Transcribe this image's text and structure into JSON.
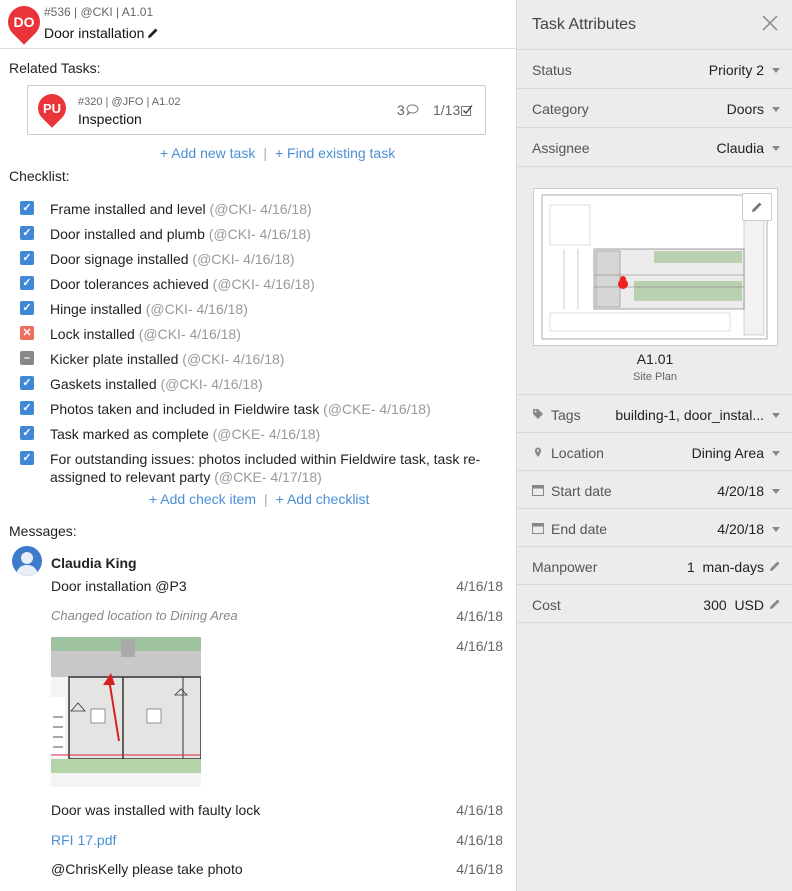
{
  "task": {
    "pin_label": "DO",
    "meta": "#536 | @CKI | A1.01",
    "title": "Door installation"
  },
  "related": {
    "label": "Related Tasks:",
    "task": {
      "pin_label": "PU",
      "meta": "#320 | @JFO | A1.02",
      "title": "Inspection",
      "comment_count": "3",
      "checklist_progress": "1/13"
    },
    "add_new": "+ Add new task",
    "separator": "|",
    "find_existing": "+ Find existing task"
  },
  "checklist": {
    "label": "Checklist:",
    "items": [
      {
        "text": "Frame installed and level",
        "by": "(@CKI- 4/16/18)",
        "status": "checked"
      },
      {
        "text": "Door installed and plumb",
        "by": "(@CKI- 4/16/18)",
        "status": "checked"
      },
      {
        "text": "Door signage installed",
        "by": "(@CKI- 4/16/18)",
        "status": "checked"
      },
      {
        "text": "Door tolerances achieved",
        "by": "(@CKI- 4/16/18)",
        "status": "checked"
      },
      {
        "text": "Hinge installed",
        "by": "(@CKI- 4/16/18)",
        "status": "checked"
      },
      {
        "text": "Lock installed",
        "by": "(@CKI- 4/16/18)",
        "status": "failed"
      },
      {
        "text": "Kicker plate installed",
        "by": "(@CKI- 4/16/18)",
        "status": "na"
      },
      {
        "text": "Gaskets installed",
        "by": "(@CKI- 4/16/18)",
        "status": "checked"
      },
      {
        "text": "Photos taken and included in Fieldwire task",
        "by": "(@CKE- 4/16/18)",
        "status": "checked"
      },
      {
        "text": "Task marked as complete",
        "by": "(@CKE- 4/16/18)",
        "status": "checked"
      },
      {
        "text": "For outstanding issues: photos included within Fieldwire task, task re-assigned to relevant party",
        "by": "(@CKE- 4/17/18)",
        "status": "checked"
      }
    ],
    "add_item": "+ Add check item",
    "separator": "|",
    "add_checklist": "+ Add checklist"
  },
  "messages": {
    "label": "Messages:",
    "author": "Claudia King",
    "items": [
      {
        "text": "Door installation @P3",
        "date": "4/16/18"
      },
      {
        "text": "Changed location to Dining Area",
        "date": "4/16/18"
      },
      {
        "text": "",
        "date": "4/16/18"
      },
      {
        "text": "Door was installed with faulty lock",
        "date": "4/16/18"
      },
      {
        "text": "RFI 17.pdf",
        "date": "4/16/18"
      },
      {
        "text": "@ChrisKelly please take photo",
        "date": "4/16/18"
      }
    ]
  },
  "attributes": {
    "title": "Task Attributes",
    "status": {
      "label": "Status",
      "value": "Priority 2"
    },
    "category": {
      "label": "Category",
      "value": "Doors"
    },
    "assignee": {
      "label": "Assignee",
      "value": "Claudia"
    },
    "plan": {
      "name": "A1.01",
      "subtitle": "Site Plan"
    },
    "tags": {
      "label": "Tags",
      "value": "building-1, door_instal..."
    },
    "location": {
      "label": "Location",
      "value": "Dining Area"
    },
    "start_date": {
      "label": "Start date",
      "value": "4/20/18"
    },
    "end_date": {
      "label": "End date",
      "value": "4/20/18"
    },
    "manpower": {
      "label": "Manpower",
      "value": "1",
      "unit": "man-days"
    },
    "cost": {
      "label": "Cost",
      "value": "300",
      "unit": "USD"
    }
  }
}
